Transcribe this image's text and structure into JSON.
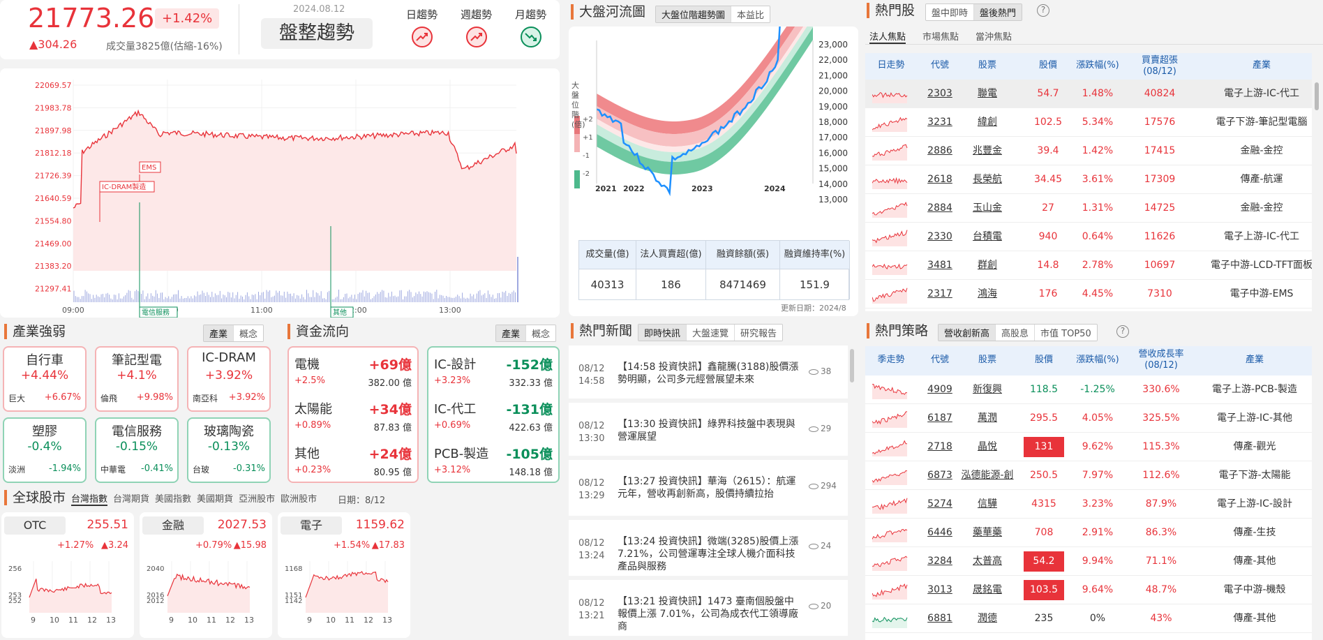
{
  "index": {
    "value": "21773.26",
    "pct": "+1.42%",
    "chg": "▲304.26",
    "vol": "成交量3825億(估縮-16%)",
    "date": "2024.08.12",
    "trend": "盤整趨勢",
    "trends": [
      {
        "label": "日趨勢",
        "dir": "up"
      },
      {
        "label": "週趨勢",
        "dir": "up"
      },
      {
        "label": "月趨勢",
        "dir": "down"
      }
    ]
  },
  "intraday": {
    "yticks": [
      "22069.57",
      "21983.78",
      "21897.98",
      "21812.18",
      "21726.39",
      "21640.59",
      "21554.80",
      "21469.00",
      "21383.20",
      "21297.41"
    ],
    "xticks": [
      "09:00",
      "10:00",
      "11:00",
      "12:00",
      "13:00"
    ],
    "tags": [
      {
        "label": "EMS",
        "color": "#e8333a"
      },
      {
        "label": "IC-DRAM製造",
        "color": "#e8333a"
      },
      {
        "label": "電信服務",
        "color": "#0a8f5a"
      },
      {
        "label": "其他",
        "color": "#0a8f5a"
      }
    ]
  },
  "river": {
    "title": "大盤河流圖",
    "tabs": [
      "大盤位階趨勢圖",
      "本益比"
    ],
    "ylabel": "大盤位階(倍)",
    "levels": [
      "+2",
      "+1",
      "-1",
      "-2"
    ],
    "yticks": [
      "23,000",
      "22,000",
      "21,000",
      "20,000",
      "19,000",
      "18,000",
      "17,000",
      "16,000",
      "15,000",
      "14,000",
      "13,000"
    ],
    "xticks": [
      "2021",
      "2022",
      "2023",
      "2024"
    ],
    "heads": [
      "成交量(億)",
      "法人買賣超(億)",
      "融資餘額(張)",
      "融資維持率(%)"
    ],
    "vals": [
      "40313",
      "186",
      "8471469",
      "151.9"
    ],
    "update": "更新日期：2024/8"
  },
  "hot": {
    "title": "熱門股",
    "tabs": [
      "盤中即時",
      "盤後熱門"
    ],
    "subtabs": [
      "法人焦點",
      "市場焦點",
      "當沖焦點"
    ],
    "heads": [
      "日走勢",
      "代號",
      "股票",
      "股價",
      "漲跌幅(%)",
      "買賣超張(08/12)",
      "產業"
    ],
    "rows": [
      {
        "code": "2303",
        "name": "聯電",
        "price": "54.7",
        "pct": "1.48%",
        "net": "40824",
        "ind": "電子上游-IC-代工"
      },
      {
        "code": "3231",
        "name": "緯創",
        "price": "102.5",
        "pct": "5.34%",
        "net": "17576",
        "ind": "電子下游-筆記型電腦"
      },
      {
        "code": "2886",
        "name": "兆豐金",
        "price": "39.4",
        "pct": "1.42%",
        "net": "17415",
        "ind": "金融-金控"
      },
      {
        "code": "2618",
        "name": "長榮航",
        "price": "34.45",
        "pct": "3.61%",
        "net": "17309",
        "ind": "傳產-航運"
      },
      {
        "code": "2884",
        "name": "玉山金",
        "price": "27",
        "pct": "1.31%",
        "net": "14725",
        "ind": "金融-金控"
      },
      {
        "code": "2330",
        "name": "台積電",
        "price": "940",
        "pct": "0.64%",
        "net": "11626",
        "ind": "電子上游-IC-代工"
      },
      {
        "code": "3481",
        "name": "群創",
        "price": "14.8",
        "pct": "2.78%",
        "net": "10697",
        "ind": "電子中游-LCD-TFT面板"
      },
      {
        "code": "2317",
        "name": "鴻海",
        "price": "176",
        "pct": "4.45%",
        "net": "7310",
        "ind": "電子中游-EMS"
      }
    ]
  },
  "industry": {
    "title": "產業強弱",
    "tabs": [
      "產業",
      "概念"
    ],
    "cards": [
      {
        "name": "自行車",
        "pct": "+4.44%",
        "stock": "巨大",
        "spct": "+6.67%",
        "up": true
      },
      {
        "name": "筆記型電",
        "pct": "+4.1%",
        "stock": "倫飛",
        "spct": "+9.98%",
        "up": true
      },
      {
        "name": "IC-DRAM",
        "pct": "+3.92%",
        "stock": "南亞科",
        "spct": "+3.92%",
        "up": true
      },
      {
        "name": "塑膠",
        "pct": "-0.4%",
        "stock": "淡洲",
        "spct": "-1.94%",
        "up": false
      },
      {
        "name": "電信服務",
        "pct": "-0.15%",
        "stock": "中華電",
        "spct": "-0.41%",
        "up": false
      },
      {
        "name": "玻璃陶瓷",
        "pct": "-0.13%",
        "stock": "台玻",
        "spct": "-0.31%",
        "up": false
      }
    ]
  },
  "flow": {
    "title": "資金流向",
    "tabs": [
      "產業",
      "概念"
    ],
    "inflow": [
      {
        "name": "電機",
        "amt": "+69億",
        "pct": "+2.5%",
        "val": "382.00 億"
      },
      {
        "name": "太陽能",
        "amt": "+34億",
        "pct": "+0.89%",
        "val": "87.83 億"
      },
      {
        "name": "其他",
        "amt": "+24億",
        "pct": "+0.23%",
        "val": "80.95 億"
      }
    ],
    "outflow": [
      {
        "name": "IC-設計",
        "amt": "-152億",
        "pct": "+3.23%",
        "val": "332.33 億"
      },
      {
        "name": "IC-代工",
        "amt": "-131億",
        "pct": "+0.69%",
        "val": "422.63 億"
      },
      {
        "name": "PCB-製造",
        "amt": "-105億",
        "pct": "+3.12%",
        "val": "148.18 億"
      }
    ]
  },
  "news": {
    "title": "熱門新聞",
    "tabs": [
      "即時快訊",
      "大盤速覽",
      "研究報告"
    ],
    "items": [
      {
        "date": "08/12",
        "time": "14:58",
        "text": "【14:58 投資快訊】鑫龍騰(3188)股價漲勢明顯，公司多元經營展望未來",
        "views": "38"
      },
      {
        "date": "08/12",
        "time": "13:30",
        "text": "【13:30 投資快訊】綠界科技盤中表現與營運展望",
        "views": "29"
      },
      {
        "date": "08/12",
        "time": "13:29",
        "text": "【13:27 投資快訊】華海（2615）：航運元年，營收再創新高，股價持續拉抬",
        "views": "294"
      },
      {
        "date": "08/12",
        "time": "13:24",
        "text": "【13:24 投資快訊】微端(3285)股價上漲7.21%，公司營運專注全球人機介面科技產品與服務",
        "views": "24"
      },
      {
        "date": "08/12",
        "time": "13:21",
        "text": "【13:21 投資快訊】1473 臺南個股盤中報價上漲 7.01%，公司為成衣代工領導廠商",
        "views": "20"
      }
    ]
  },
  "strategy": {
    "title": "熱門策略",
    "tabs": [
      "營收創新高",
      "高股息",
      "市值 TOP50"
    ],
    "heads": [
      "季走勢",
      "代號",
      "股票",
      "股價",
      "漲跌幅(%)",
      "營收成長率(08/12)",
      "產業"
    ],
    "rows": [
      {
        "code": "4909",
        "name": "新復興",
        "price": "118.5",
        "pct": "-1.25%",
        "growth": "330.6%",
        "ind": "電子上游-PCB-製造",
        "limit": false,
        "dir": "down"
      },
      {
        "code": "6187",
        "name": "萬潤",
        "price": "295.5",
        "pct": "4.05%",
        "growth": "325.5%",
        "ind": "電子上游-IC-其他",
        "limit": false,
        "dir": "up"
      },
      {
        "code": "2718",
        "name": "晶悅",
        "price": "131",
        "pct": "9.62%",
        "growth": "115.3%",
        "ind": "傳產-觀光",
        "limit": true,
        "dir": "up"
      },
      {
        "code": "6873",
        "name": "泓德能源-創",
        "price": "250.5",
        "pct": "7.97%",
        "growth": "112.6%",
        "ind": "電子下游-太陽能",
        "limit": false,
        "dir": "up"
      },
      {
        "code": "5274",
        "name": "信驊",
        "price": "4315",
        "pct": "3.23%",
        "growth": "87.9%",
        "ind": "電子上游-IC-設計",
        "limit": false,
        "dir": "up"
      },
      {
        "code": "6446",
        "name": "藥華藥",
        "price": "708",
        "pct": "2.91%",
        "growth": "86.3%",
        "ind": "傳產-生技",
        "limit": false,
        "dir": "up"
      },
      {
        "code": "3284",
        "name": "太普高",
        "price": "54.2",
        "pct": "9.94%",
        "growth": "71.1%",
        "ind": "傳產-其他",
        "limit": true,
        "dir": "up"
      },
      {
        "code": "3013",
        "name": "晟銘電",
        "price": "103.5",
        "pct": "9.64%",
        "growth": "48.7%",
        "ind": "電子中游-機殼",
        "limit": true,
        "dir": "up"
      },
      {
        "code": "6881",
        "name": "潤德",
        "price": "235",
        "pct": "0%",
        "growth": "43%",
        "ind": "傳產-其他",
        "limit": false,
        "dir": "flat"
      }
    ]
  },
  "global": {
    "title": "全球股市",
    "tabs": [
      "台灣指數",
      "台灣期貨",
      "美國指數",
      "美國期貨",
      "亞洲股市",
      "歐洲股市"
    ],
    "date": "日期：8/12",
    "cards": [
      {
        "name": "OTC",
        "value": "255.51",
        "pct": "+1.27%",
        "chg": "▲3.24",
        "yticks": [
          "256",
          "253",
          "252"
        ]
      },
      {
        "name": "金融",
        "value": "2027.53",
        "pct": "+0.79%",
        "chg": "▲15.98",
        "yticks": [
          "2040",
          "2016",
          "2012"
        ]
      },
      {
        "name": "電子",
        "value": "1159.62",
        "pct": "+1.54%",
        "chg": "▲17.83",
        "yticks": [
          "1168",
          "1151",
          "1142"
        ]
      }
    ],
    "xticks": [
      "9",
      "10",
      "11",
      "12",
      "13"
    ]
  },
  "colors": {
    "up": "#e8333a",
    "down": "#0a8f5a",
    "accent": "#e8763a",
    "header_bg": "#e9f1fb",
    "header_text": "#1a5aa8",
    "river_line": "#1e90ff"
  }
}
